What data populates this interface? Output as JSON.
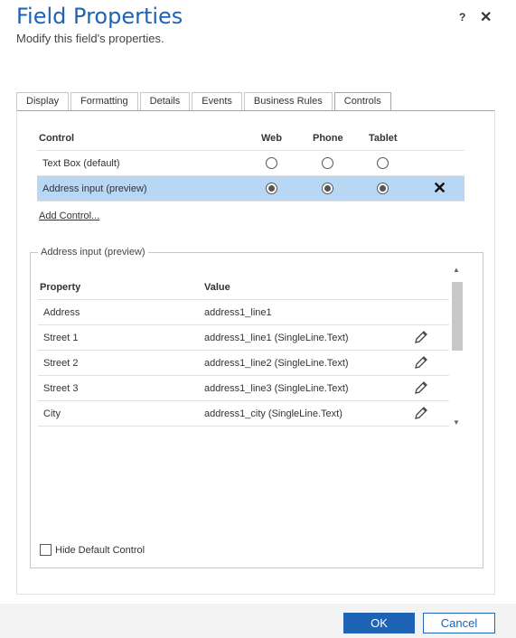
{
  "dialog": {
    "title": "Field Properties",
    "subtitle": "Modify this field's properties.",
    "help_label": "?",
    "close_label": "✕"
  },
  "tabs": [
    {
      "label": "Display"
    },
    {
      "label": "Formatting"
    },
    {
      "label": "Details"
    },
    {
      "label": "Events"
    },
    {
      "label": "Business Rules"
    },
    {
      "label": "Controls",
      "active": true
    }
  ],
  "controls": {
    "headers": {
      "control": "Control",
      "web": "Web",
      "phone": "Phone",
      "tablet": "Tablet"
    },
    "rows": [
      {
        "name": "Text Box (default)",
        "web": false,
        "phone": false,
        "tablet": false
      },
      {
        "name": "Address input (preview)",
        "web": true,
        "phone": true,
        "tablet": true,
        "selected": true,
        "remove_icon": "close-icon"
      }
    ],
    "add_control_label": "Add Control..."
  },
  "properties": {
    "legend": "Address input (preview)",
    "headers": {
      "property": "Property",
      "value": "Value"
    },
    "rows": [
      {
        "property": "Address",
        "value": "address1_line1",
        "editable": false
      },
      {
        "property": "Street 1",
        "value": "address1_line1 (SingleLine.Text)",
        "editable": true
      },
      {
        "property": "Street 2",
        "value": "address1_line2 (SingleLine.Text)",
        "editable": true
      },
      {
        "property": "Street 3",
        "value": "address1_line3 (SingleLine.Text)",
        "editable": true
      },
      {
        "property": "City",
        "value": "address1_city (SingleLine.Text)",
        "editable": true
      }
    ],
    "hide_default_label": "Hide Default Control",
    "hide_default_checked": false
  },
  "footer": {
    "ok_label": "OK",
    "cancel_label": "Cancel"
  },
  "colors": {
    "accent": "#1e63b4",
    "selected_row": "#b7d7f5"
  }
}
